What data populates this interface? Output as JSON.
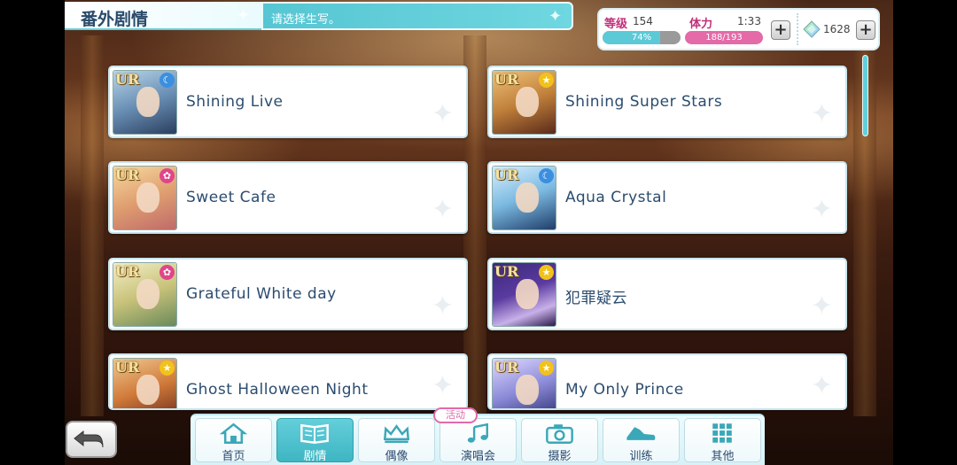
{
  "header": {
    "title": "番外剧情",
    "subtitle": "请选择生写。"
  },
  "status": {
    "level_label": "等级",
    "level_value": "154",
    "exp_percent_text": "74%",
    "exp_fraction": 0.74,
    "stamina_label": "体力",
    "stamina_timer": "1:33",
    "stamina_text": "188/193",
    "stamina_fraction": 0.974,
    "gem_count": "1628",
    "plus_label": "+"
  },
  "stories": [
    {
      "title": "Shining Live",
      "rarity": "UR",
      "attribute": "moon-icon",
      "badge_color": "#3a8fe0"
    },
    {
      "title": "Shining Super Stars",
      "rarity": "UR",
      "attribute": "star-icon",
      "badge_color": "#f2c21a"
    },
    {
      "title": "Sweet Cafe",
      "rarity": "UR",
      "attribute": "gear-icon",
      "badge_color": "#e0468a"
    },
    {
      "title": "Aqua Crystal",
      "rarity": "UR",
      "attribute": "moon-icon",
      "badge_color": "#3a8fe0"
    },
    {
      "title": "Grateful White day",
      "rarity": "UR",
      "attribute": "gear-icon",
      "badge_color": "#e0468a"
    },
    {
      "title": "犯罪疑云",
      "rarity": "UR",
      "attribute": "star-icon",
      "badge_color": "#f2c21a"
    },
    {
      "title": "Ghost Halloween Night",
      "rarity": "UR",
      "attribute": "star-icon",
      "badge_color": "#f2c21a"
    },
    {
      "title": "My Only Prince",
      "rarity": "UR",
      "attribute": "star-icon",
      "badge_color": "#f2c21a"
    }
  ],
  "nav": {
    "home": "首页",
    "story": "剧情",
    "idol": "偶像",
    "live": "演唱会",
    "photo": "摄影",
    "training": "训练",
    "other": "其他",
    "event_badge": "活动"
  },
  "colors": {
    "accent": "#5fd0dc",
    "pink": "#e46aa8",
    "title_text": "#2b4c6f"
  }
}
